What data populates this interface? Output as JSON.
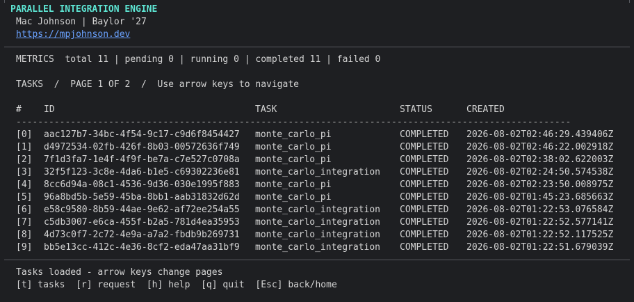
{
  "brand": {
    "title": "PARALLEL INTEGRATION ENGINE",
    "subtitle": "Mac Johnson | Baylor '27",
    "link": "https://mpjohnson.dev"
  },
  "metrics": {
    "text": "METRICS  total 11 | pending 0 | running 0 | completed 11 | failed 0"
  },
  "tasks_header": {
    "text": "TASKS  /  PAGE 1 OF 2  /  Use arrow keys to navigate"
  },
  "table": {
    "columns": [
      "#",
      "ID",
      "TASK",
      "STATUS",
      "CREATED"
    ],
    "separator": "------------------------------------------------------------------------------------------------------",
    "rows": [
      {
        "idx": "[0]",
        "id": "aac127b7-34bc-4f54-9c17-c9d6f8454427",
        "task": "monte_carlo_pi",
        "status": "COMPLETED",
        "created": "2026-08-02T02:46:29.439406Z"
      },
      {
        "idx": "[1]",
        "id": "d4972534-02fb-426f-8b03-00572636f749",
        "task": "monte_carlo_pi",
        "status": "COMPLETED",
        "created": "2026-08-02T02:46:22.002918Z"
      },
      {
        "idx": "[2]",
        "id": "7f1d3fa7-1e4f-4f9f-be7a-c7e527c0708a",
        "task": "monte_carlo_pi",
        "status": "COMPLETED",
        "created": "2026-08-02T02:38:02.622003Z"
      },
      {
        "idx": "[3]",
        "id": "32f5f123-3c8e-4da6-b1e5-c69302236e81",
        "task": "monte_carlo_integration",
        "status": "COMPLETED",
        "created": "2026-08-02T02:24:50.574538Z"
      },
      {
        "idx": "[4]",
        "id": "8cc6d94a-08c1-4536-9d36-030e1995f883",
        "task": "monte_carlo_pi",
        "status": "COMPLETED",
        "created": "2026-08-02T02:23:50.008975Z"
      },
      {
        "idx": "[5]",
        "id": "96a8bd5b-5e59-45ba-8bb1-aab31832d62d",
        "task": "monte_carlo_pi",
        "status": "COMPLETED",
        "created": "2026-08-02T01:45:23.685663Z"
      },
      {
        "idx": "[6]",
        "id": "e58c9580-8b59-44ae-9e62-af72ee254a55",
        "task": "monte_carlo_integration",
        "status": "COMPLETED",
        "created": "2026-08-02T01:22:53.076584Z"
      },
      {
        "idx": "[7]",
        "id": "c5db3007-e6ca-455f-b2a5-781d4ea35953",
        "task": "monte_carlo_integration",
        "status": "COMPLETED",
        "created": "2026-08-02T01:22:52.577141Z"
      },
      {
        "idx": "[8]",
        "id": "4d73c0f7-2c72-4e9a-a7a2-fbdb9b269731",
        "task": "monte_carlo_integration",
        "status": "COMPLETED",
        "created": "2026-08-02T01:22:52.117525Z"
      },
      {
        "idx": "[9]",
        "id": "bb5e13cc-412c-4e36-8cf2-eda47aa31bf9",
        "task": "monte_carlo_integration",
        "status": "COMPLETED",
        "created": "2026-08-02T01:22:51.679039Z"
      }
    ]
  },
  "footer": {
    "status": "Tasks loaded - arrow keys change pages",
    "keys": "[t] tasks  [r] request  [h] help  [q] quit  [Esc] back/home"
  },
  "colors": {
    "background": "#1e1f22",
    "text": "#d4d4d4",
    "title": "#5ee6d4",
    "link": "#6aa2ff",
    "divider": "#585a60"
  }
}
